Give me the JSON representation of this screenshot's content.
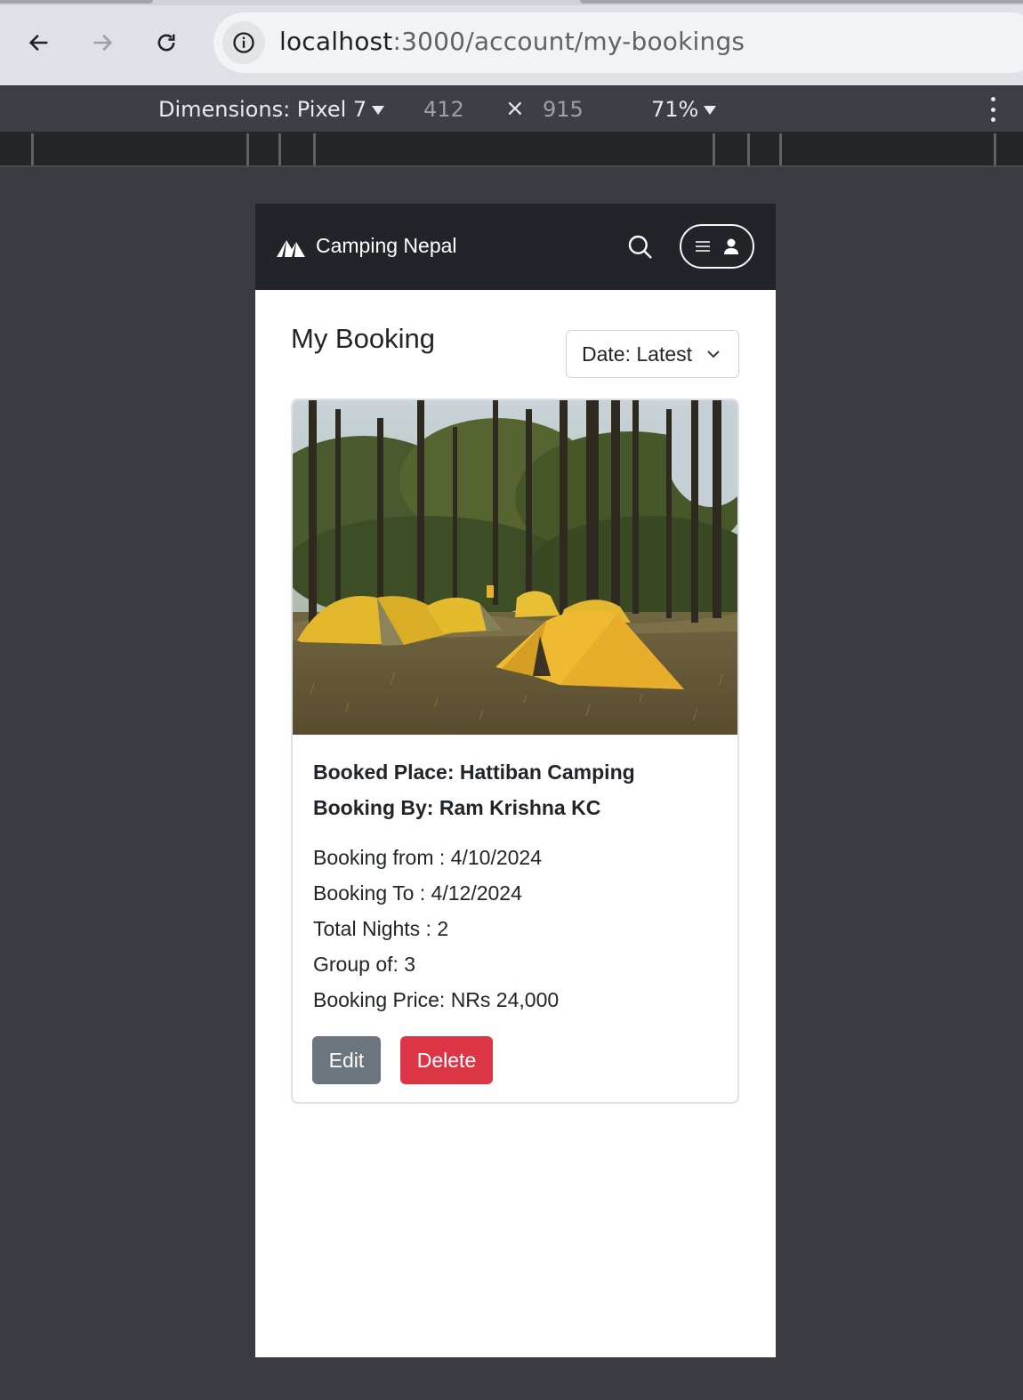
{
  "browser": {
    "url_host": "localhost",
    "url_path": ":3000/account/my-bookings"
  },
  "devtools": {
    "dimensions_label": "Dimensions: Pixel 7",
    "width": "412",
    "times": "×",
    "height": "915",
    "zoom": "71%"
  },
  "app": {
    "brand": "Camping Nepal",
    "page_title": "My Booking",
    "sort_value": "Date: Latest"
  },
  "booking": {
    "place": "Booked Place: Hattiban Camping",
    "by": "Booking By: Ram Krishna KC",
    "from": "Booking from : 4/10/2024",
    "to": "Booking To : 4/12/2024",
    "nights": "Total Nights : 2",
    "group": "Group of: 3",
    "price": "Booking Price: NRs 24,000",
    "edit_label": "Edit",
    "delete_label": "Delete"
  },
  "colors": {
    "navbar": "#212529",
    "edit": "#6c757d",
    "delete": "#dc3545",
    "tent": "#e8b529"
  }
}
